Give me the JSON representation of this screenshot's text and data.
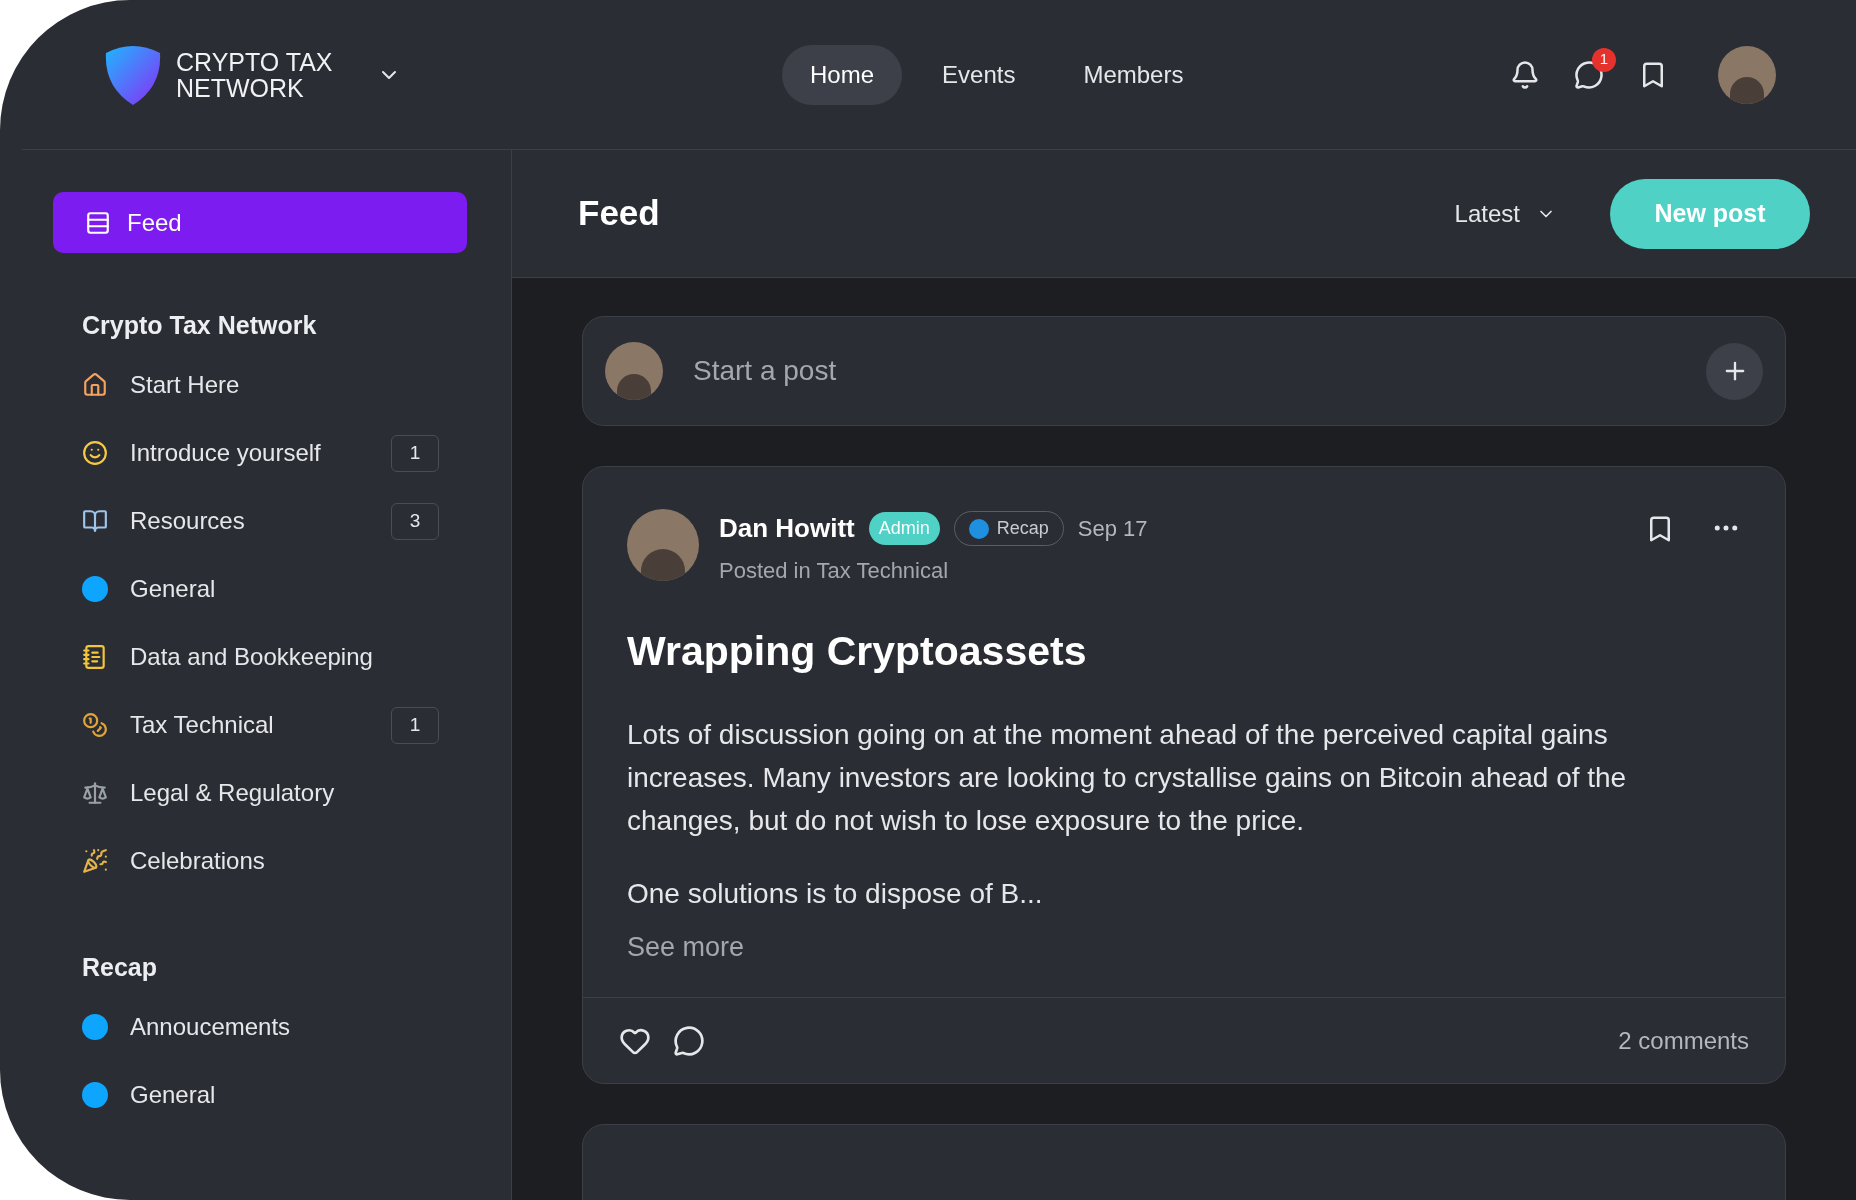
{
  "brand": {
    "line1": "CRYPTO TAX",
    "line2": "NETWORK"
  },
  "nav": [
    {
      "label": "Home",
      "selected": true
    },
    {
      "label": "Events",
      "selected": false
    },
    {
      "label": "Members",
      "selected": false
    }
  ],
  "header_icons": {
    "chat_badge": "1"
  },
  "sidebar": {
    "feed": {
      "label": "Feed",
      "selected": true
    },
    "sections": [
      {
        "title": "Crypto Tax Network",
        "items": [
          {
            "kind": "house",
            "label": "Start Here"
          },
          {
            "kind": "smile",
            "label": "Introduce yourself",
            "count": "1"
          },
          {
            "kind": "book",
            "label": "Resources",
            "count": "3"
          },
          {
            "kind": "dot",
            "color": "#0ea5ff",
            "label": "General"
          },
          {
            "kind": "notebook",
            "label": "Data and Bookkeeping"
          },
          {
            "kind": "moneybag",
            "label": "Tax Technical",
            "count": "1"
          },
          {
            "kind": "scales",
            "label": "Legal & Regulatory"
          },
          {
            "kind": "party",
            "label": "Celebrations"
          }
        ]
      },
      {
        "title": "Recap",
        "items": [
          {
            "kind": "dot",
            "color": "#0ea5ff",
            "label": "Annoucements"
          },
          {
            "kind": "dot",
            "color": "#0ea5ff",
            "label": "General"
          }
        ]
      }
    ]
  },
  "feed_header": {
    "title": "Feed",
    "sort": "Latest",
    "new_post": "New post"
  },
  "composer": {
    "placeholder": "Start a post"
  },
  "posts": [
    {
      "author": "Dan Howitt",
      "role": "Admin",
      "space": "Recap",
      "date": "Sep 17",
      "posted_in": "Posted in Tax Technical",
      "title": "Wrapping Cryptoassets",
      "paragraphs": [
        "Lots of discussion going on at the moment ahead of the perceived capital gains increases. Many investors are looking to crystallise gains on Bitcoin ahead of the changes, but do not wish to lose exposure to the price.",
        "One solutions is to dispose of B..."
      ],
      "see_more": "See more",
      "comments": "2 comments"
    }
  ]
}
